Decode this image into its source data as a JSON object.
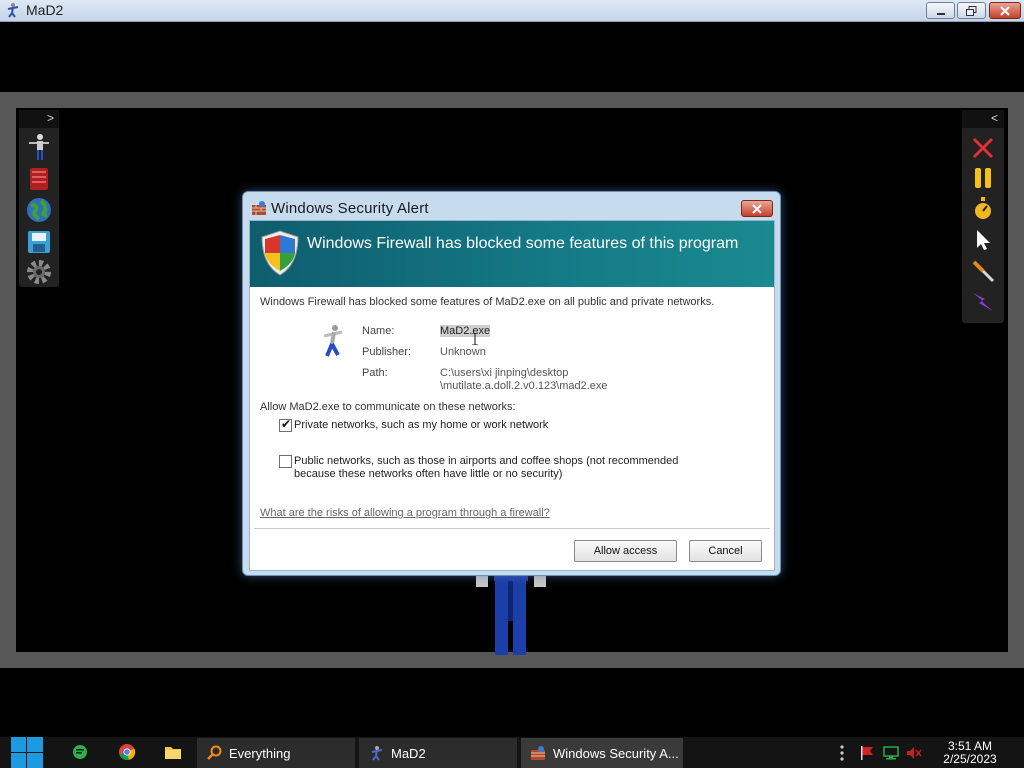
{
  "app": {
    "title": "MaD2"
  },
  "dialog": {
    "title": "Windows Security Alert",
    "heading": "Windows Firewall has blocked some features of this program",
    "intro": "Windows Firewall has blocked some features of MaD2.exe on all public and private networks.",
    "fields": [
      {
        "label": "Name:",
        "value": "MaD2.exe"
      },
      {
        "label": "Publisher:",
        "value": "Unknown"
      },
      {
        "label": "Path:",
        "value_line1": "C:\\users\\xi jinping\\desktop",
        "value_line2": "\\mutilate.a.doll.2.v0.123\\mad2.exe"
      }
    ],
    "allow_text": "Allow MaD2.exe to communicate on these networks:",
    "private_network": {
      "label": "Private networks, such as my home or work network",
      "checked": true
    },
    "public_network": {
      "label_line1": "Public networks, such as those in airports and coffee shops (not recommended",
      "label_line2": "because these networks often have little or no security)",
      "checked": false
    },
    "risk_link": "What are the risks of allowing a program through a firewall?",
    "allow_button": "Allow access",
    "cancel_button": "Cancel"
  },
  "left_toolbar": {
    "toggle": ">",
    "tools": [
      "ragdoll-icon",
      "book-icon",
      "globe-icon",
      "save-disk-icon",
      "gear-icon"
    ]
  },
  "right_toolbar": {
    "toggle": "<",
    "tools": [
      "red-x-icon",
      "pause-icon",
      "stopwatch-icon",
      "pointer-icon",
      "knife-icon",
      "lightning-icon"
    ]
  },
  "taskbar": {
    "tasks": [
      {
        "label": "Everything"
      },
      {
        "label": "MaD2"
      },
      {
        "label": "Windows Security A..."
      }
    ],
    "clock_time": "3:51 AM",
    "clock_date": "2/25/2023"
  },
  "colors": {
    "banner": "#157a87",
    "taskbar": "#141414",
    "ragdoll": "#1c3ea8"
  }
}
